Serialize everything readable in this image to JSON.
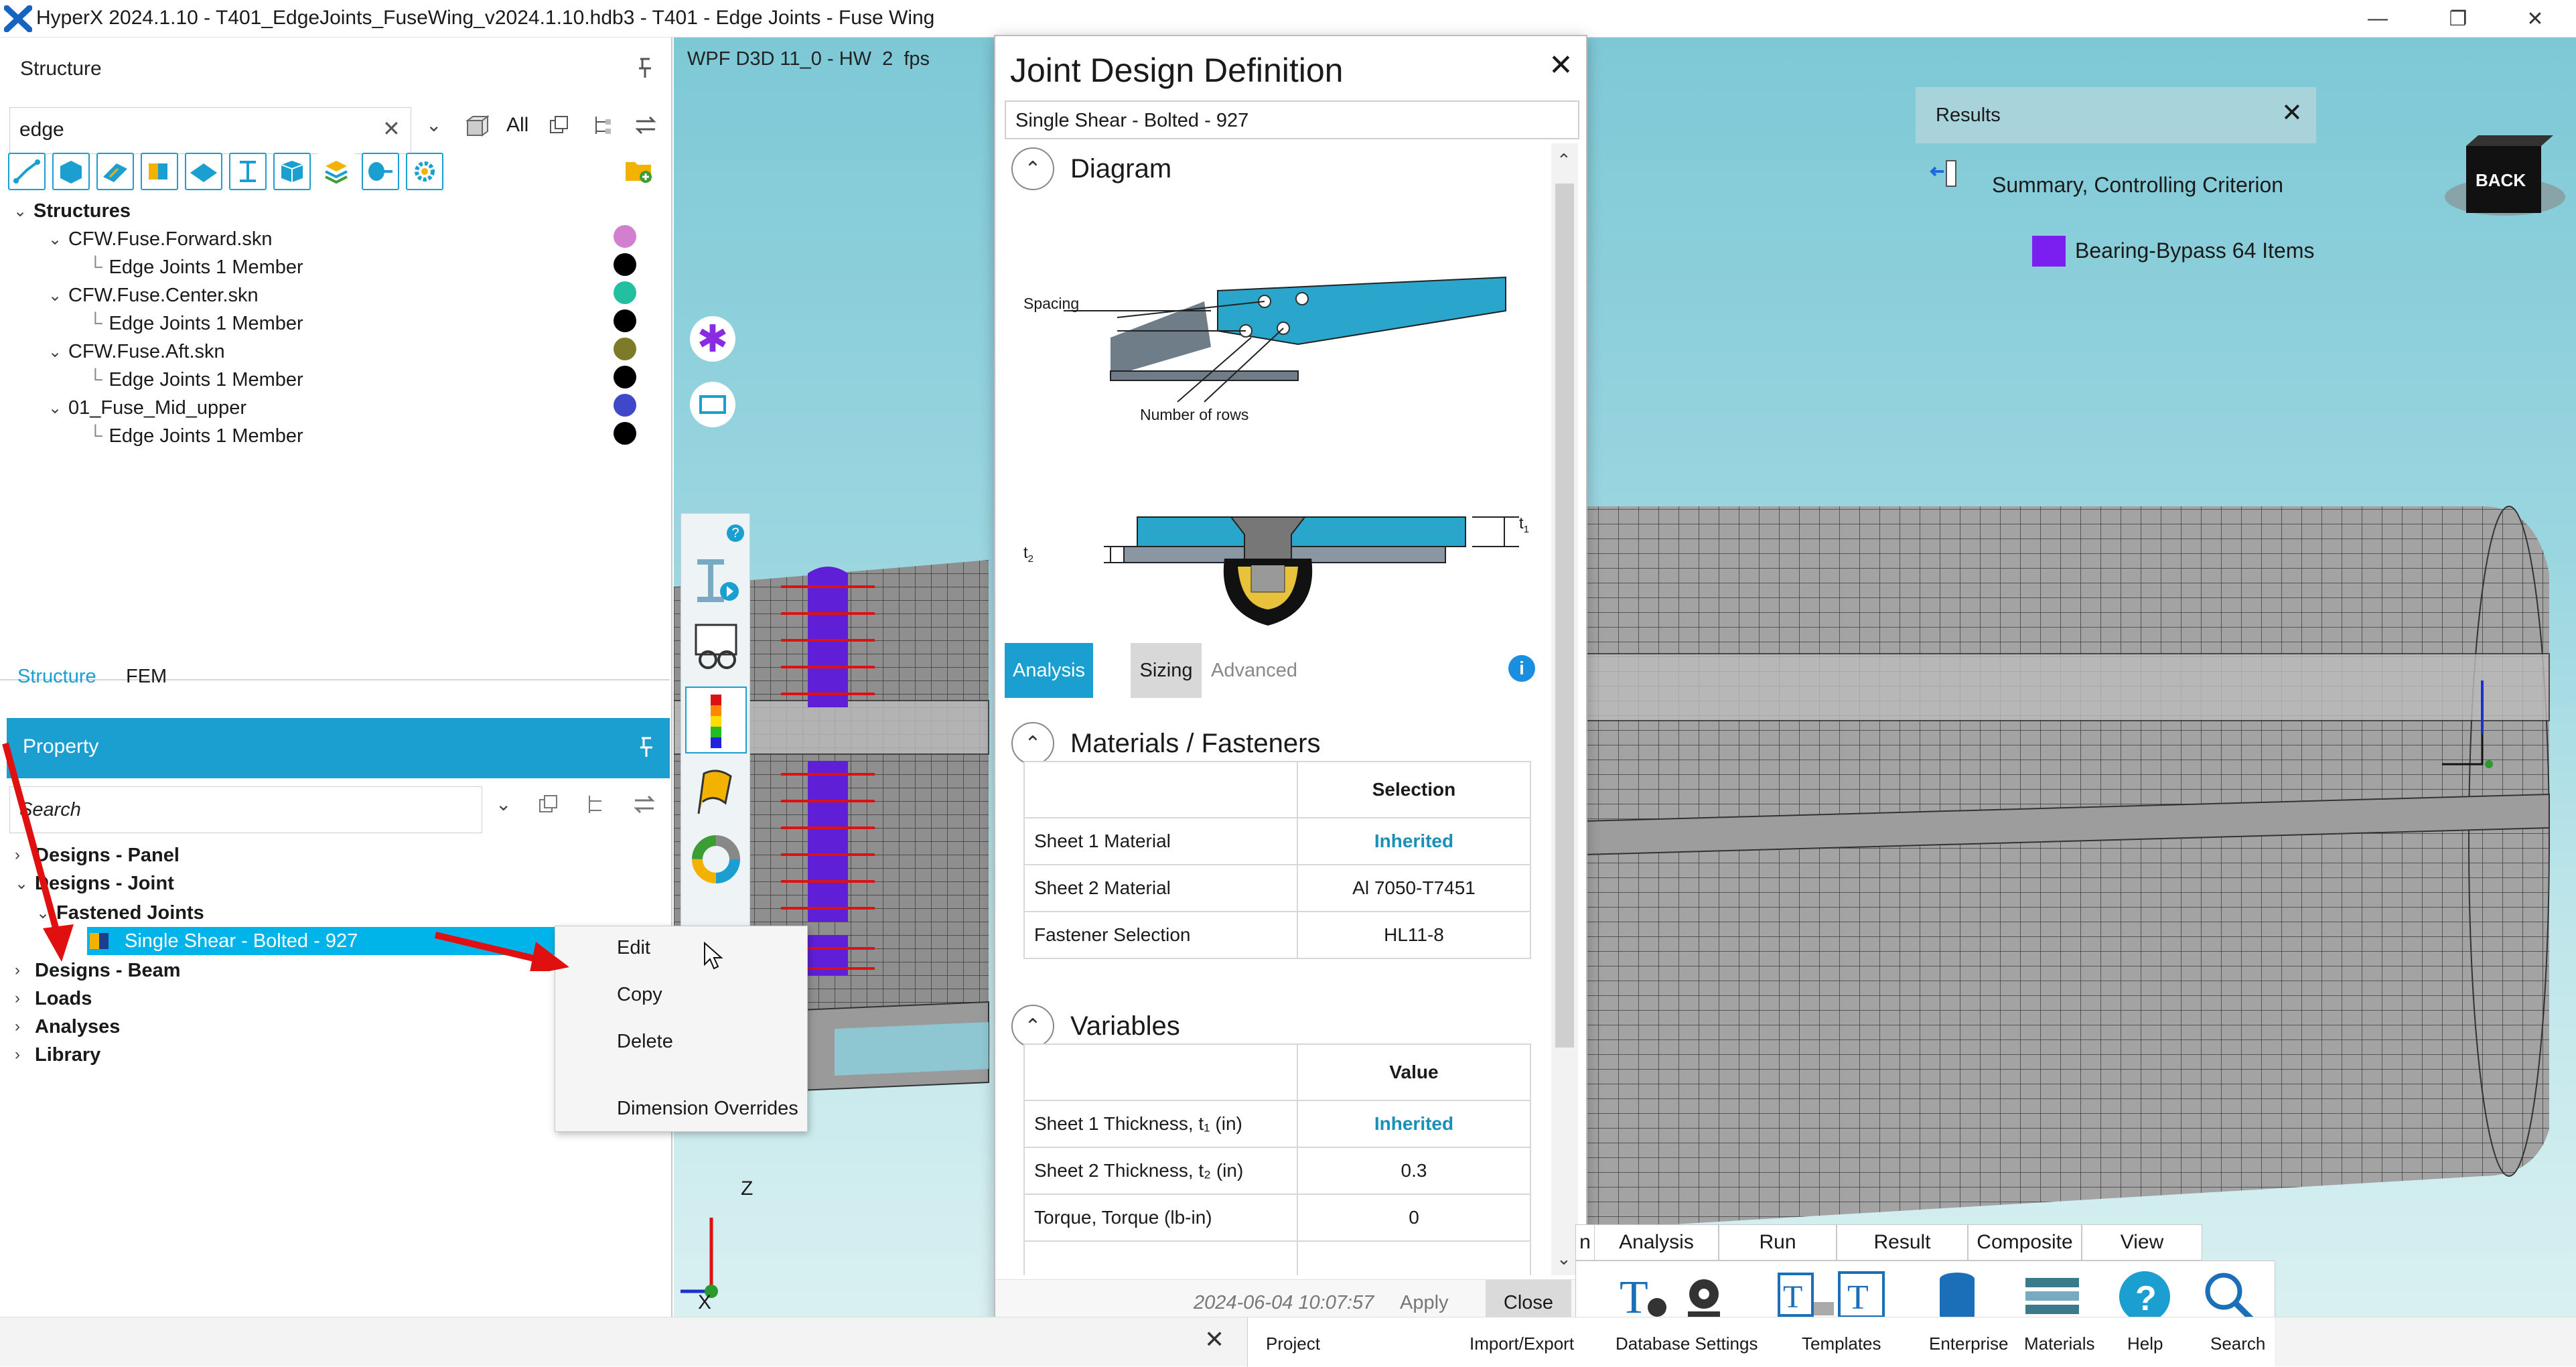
{
  "window": {
    "title": "HyperX 2024.1.10 - T401_EdgeJoints_FuseWing_v2024.1.10.hdb3 - T401 - Edge Joints - Fuse Wing"
  },
  "structure_panel": {
    "title": "Structure",
    "search_value": "edge",
    "all_label": "All",
    "tree": [
      {
        "label": "Structures",
        "level": 0
      },
      {
        "label": "CFW.Fuse.Forward.skn",
        "level": 1,
        "color": "#d27fd0"
      },
      {
        "label": "Edge Joints 1 Member",
        "level": 2,
        "color": "#000000"
      },
      {
        "label": "CFW.Fuse.Center.skn",
        "level": 1,
        "color": "#22c0a0"
      },
      {
        "label": "Edge Joints 1 Member",
        "level": 2,
        "color": "#000000"
      },
      {
        "label": "CFW.Fuse.Aft.skn",
        "level": 1,
        "color": "#7d7a2a"
      },
      {
        "label": "Edge Joints 1 Member",
        "level": 2,
        "color": "#000000"
      },
      {
        "label": "01_Fuse_Mid_upper",
        "level": 1,
        "color": "#3f48c8"
      },
      {
        "label": "Edge Joints 1 Member",
        "level": 2,
        "color": "#000000"
      }
    ],
    "tabs": [
      "Structure",
      "FEM"
    ]
  },
  "property_panel": {
    "title": "Property",
    "search_placeholder": "Search",
    "tree": {
      "designs_panel": "Designs - Panel",
      "designs_joint": "Designs - Joint",
      "fastened_joints": "Fastened Joints",
      "selected_item": "Single Shear - Bolted - 927",
      "designs_beam": "Designs - Beam",
      "loads": "Loads",
      "analyses": "Analyses",
      "library": "Library"
    }
  },
  "context_menu": {
    "items": [
      "Edit",
      "Copy",
      "Delete",
      "Dimension Overrides"
    ]
  },
  "viewport": {
    "label": "WPF D3D 11_0 - HW  2  fps",
    "back_label": "BACK",
    "axes": {
      "z": "Z",
      "x": "X"
    }
  },
  "results": {
    "title": "Results",
    "summary": "Summary, Controlling Criterion",
    "legend_label": "Bearing-Bypass 64 Items",
    "legend_color": "#7a1ff0"
  },
  "dialog": {
    "title": "Joint Design Definition",
    "name_value": "Single Shear - Bolted - 927",
    "diagram_title": "Diagram",
    "diagram_labels": {
      "spacing": "Spacing",
      "rows": "Number of rows",
      "t1": "t",
      "t1_sub": "1",
      "t2": "t",
      "t2_sub": "2"
    },
    "tabs": [
      "Analysis",
      "Sizing",
      "Advanced"
    ],
    "materials_title": "Materials / Fasteners",
    "materials_header": "Selection",
    "materials": [
      {
        "label": "Sheet 1 Material",
        "value": "Inherited"
      },
      {
        "label": "Sheet 2 Material",
        "value": "Al 7050-T7451"
      },
      {
        "label": "Fastener Selection",
        "value": "HL11-8"
      }
    ],
    "variables_title": "Variables",
    "variables_header": "Value",
    "variables": [
      {
        "label": "Sheet 1 Thickness, t₁ (in)",
        "value": "Inherited"
      },
      {
        "label": "Sheet 2 Thickness, t₂ (in)",
        "value": "0.3"
      },
      {
        "label": "Torque, Torque (lb-in)",
        "value": "0"
      }
    ],
    "timestamp": "2024-06-04 10:07:57",
    "apply_label": "Apply",
    "close_label": "Close"
  },
  "ribbon": {
    "tabs": [
      "n",
      "Analysis",
      "Run",
      "Result",
      "Composite",
      "View"
    ],
    "buttons": [
      "Project",
      "Import/Export",
      "Database Settings",
      "Templates",
      "Enterprise",
      "Materials",
      "Help",
      "Search"
    ]
  }
}
